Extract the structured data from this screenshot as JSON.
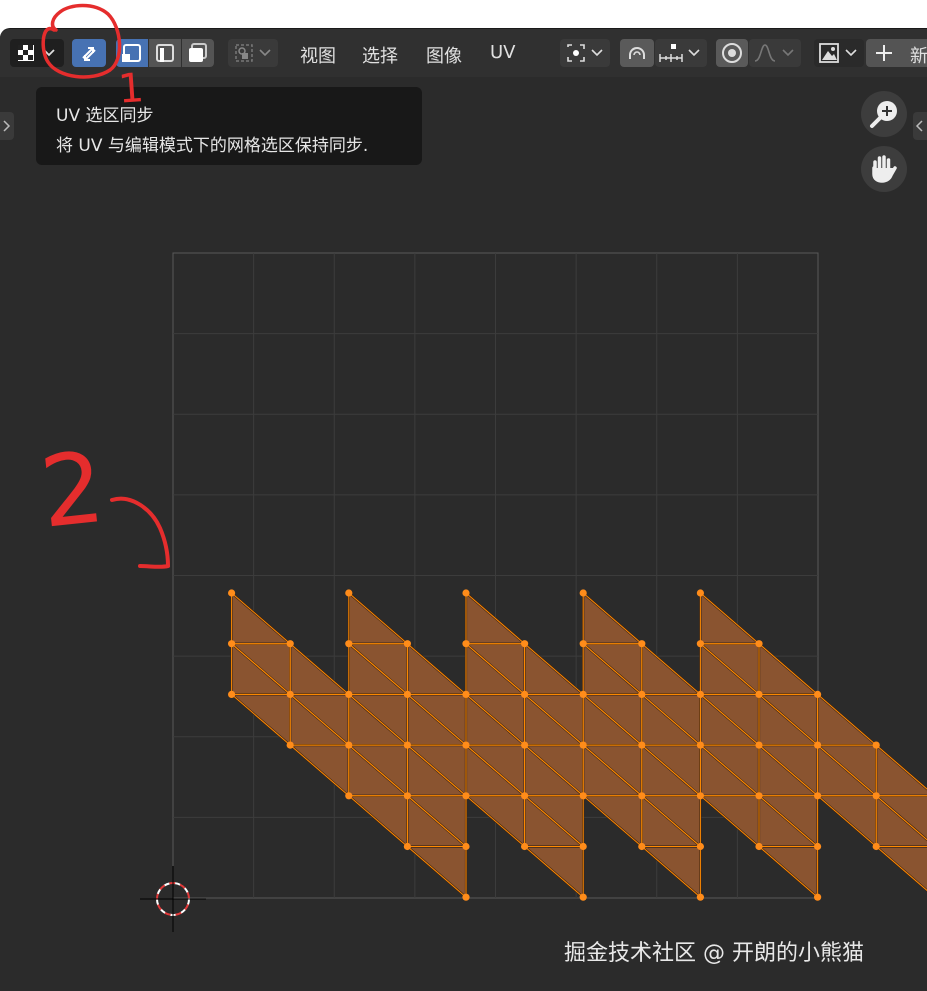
{
  "header": {
    "menus": [
      "视图",
      "选择",
      "图像",
      "UV"
    ],
    "new_label": "新"
  },
  "tooltip": {
    "title": "UV 选区同步",
    "description": "将 UV 与编辑模式下的网格选区保持同步."
  },
  "annotations": [
    "1",
    "2"
  ],
  "watermark": "掘金技术社区 @ 开朗的小熊猫",
  "colors": {
    "face_fill": "#8a5430",
    "edge": "#ff8a00",
    "vertex": "#ff8c1a",
    "grid_line": "#3c3c3c",
    "background": "#2b2b2b",
    "active_button": "#4772b3",
    "annotation": "#e52d2d"
  }
}
